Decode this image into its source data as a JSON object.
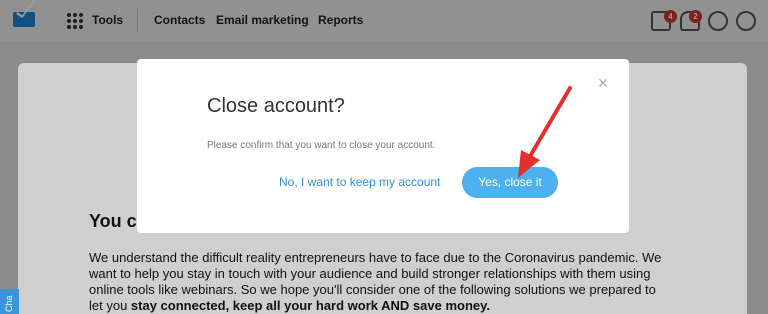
{
  "nav": {
    "tools": "Tools",
    "contacts": "Contacts",
    "email_marketing": "Email marketing",
    "reports": "Reports",
    "badge_learn": "4",
    "badge_notifications": "2"
  },
  "page": {
    "heading": "You ca",
    "paragraph_lines": [
      "We understand the difficult reality entrepreneurs have to face due to the Coronavirus pandemic. We",
      "want to help you stay in touch with your audience and build stronger relationships with them using",
      "online tools like webinars. So we hope you'll consider one of the following solutions we prepared to"
    ],
    "last_line_prefix": "let you ",
    "last_line_bold": "stay connected, keep all your hard work AND save money.",
    "chat_tab": "Cha"
  },
  "modal": {
    "title": "Close account?",
    "message": "Please confirm that you want to close your account.",
    "keep_label": "No, I want to keep my account",
    "confirm_label": "Yes, close it",
    "close_glyph": "×"
  },
  "colors": {
    "primary": "#4db0ef",
    "link": "#2d8fd8",
    "badge": "#d9322b",
    "annotation_arrow": "#e2302b"
  }
}
